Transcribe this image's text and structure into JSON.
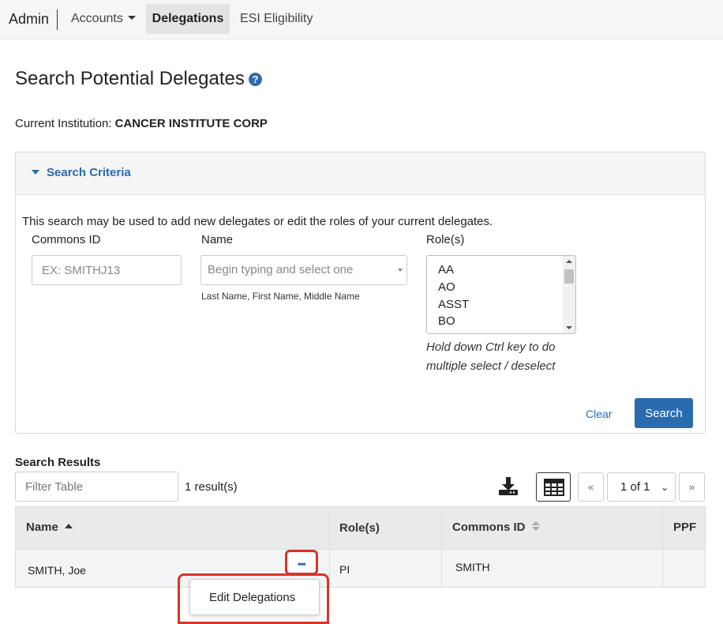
{
  "nav": {
    "brand": "Admin",
    "items": [
      {
        "label": "Accounts"
      },
      {
        "label": "Delegations"
      },
      {
        "label": "ESI Eligibility"
      }
    ]
  },
  "page": {
    "title": "Search Potential Delegates",
    "help_icon": "question-circle-icon",
    "institution_label": "Current Institution:",
    "institution_value": "CANCER INSTITUTE CORP"
  },
  "search": {
    "panel_title": "Search Criteria",
    "intro": "This search may be used to add new delegates or edit the roles of your current delegates.",
    "commons_label": "Commons ID",
    "commons_placeholder": "EX: SMITHJ13",
    "name_label": "Name",
    "name_placeholder": "Begin typing and select one",
    "name_hint": "Last Name, First Name, Middle Name",
    "roles_label": "Role(s)",
    "roles_options": [
      "AA",
      "AO",
      "ASST",
      "BO"
    ],
    "roles_hint": "Hold down Ctrl key to do multiple select / deselect",
    "clear_label": "Clear",
    "search_label": "Search",
    "colors": {
      "accent": "#2a6bb0",
      "highlight": "#d9342b"
    }
  },
  "results": {
    "title": "Search Results",
    "filter_placeholder": "Filter Table",
    "count": "1 result(s)",
    "pagination": {
      "prev": "«",
      "current": "1 of 1",
      "next": "»"
    },
    "icons": {
      "download": "download-icon",
      "columns": "table-grid-icon"
    },
    "columns": [
      "Name",
      "Role(s)",
      "Commons ID",
      "PPF"
    ],
    "rows": [
      {
        "name": "SMITH, Joe",
        "roles": "PI",
        "commons_id": "SMITH",
        "ppf": ""
      }
    ],
    "row_menu": {
      "more_label": "•••",
      "items": [
        "Edit Delegations"
      ]
    }
  }
}
